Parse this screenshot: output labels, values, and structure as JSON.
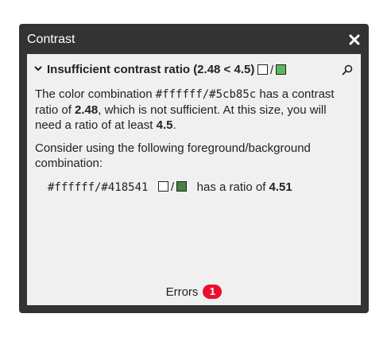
{
  "dialog": {
    "title": "Contrast",
    "close_icon": "close-icon"
  },
  "issue": {
    "heading": "Insufficient contrast ratio (2.48 < 4.5)",
    "foreground": "#ffffff",
    "background": "#5cb85c",
    "slash": "/",
    "paragraph1": {
      "t1": "The color combination ",
      "combo": "#ffffff/#5cb85c",
      "t2": " has a contrast ratio of ",
      "ratio": "2.48",
      "t3": ", which is not sufficient. At this size, you will need a ratio of at least ",
      "required": "4.5",
      "t4": "."
    },
    "paragraph2": "Consider using the following foreground/background combination:"
  },
  "suggestion": {
    "combo": "#ffffff/#418541",
    "foreground": "#ffffff",
    "background": "#418541",
    "slash": "/",
    "ratio_text": "has a ratio of",
    "ratio": "4.51"
  },
  "footer": {
    "label": "Errors",
    "count": "1",
    "badge_color": "#e8112d"
  },
  "colors": {
    "dialog_bg": "#333333",
    "panel_bg": "#f0f0f0"
  }
}
